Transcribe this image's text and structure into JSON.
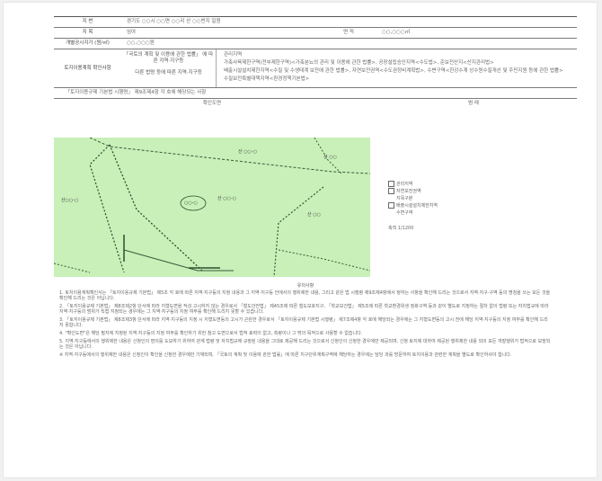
{
  "document": {
    "row1": {
      "label": "지 번",
      "value": "경기도 ○○시 ○○면 ○○리 산 ○○번지 일원"
    },
    "row2": {
      "label": "지 목",
      "value": "임야",
      "label2": "면 적",
      "value2": "○○,○○○㎡"
    },
    "row3": {
      "label": "개별공시지가 (원/㎡)",
      "value": "○○,○○○원"
    },
    "block": {
      "label": "토지이용계획 확인사항",
      "mid_items": [
        "「국토의 계획 및 이용에 관한 법률」 에 따른 지역·지구등",
        "다른 법령 등에 따른 지역·지구등"
      ],
      "right_head": "관리지역",
      "right_lines": [
        "가축사육제한구역(전부제한구역)<가축분뇨의 관리 및 이용에 관한 법률>, 공장설립승인지역<수도법>, 준보전산지<산지관리법>",
        "배출시설설치제한지역<수질 및 수생태계 보전에 관한 법률>, 자연보전권역<수도권정비계획법>, 수변구역<한강수계 상수원수질개선 및 주민지원 등에 관한 법률>",
        "수질보전특별대책지역<환경정책기본법>"
      ],
      "bottom_label": "「토지이용규제 기본법 시행령」 제9조제4항 각 호에 해당되는 사항"
    },
    "map_header": {
      "left": "확인도면",
      "right": "범 례"
    },
    "map_labels": {
      "a": "산 ○○-○",
      "b": "산 ○○",
      "c": "산○○-○",
      "d": "산 ○○-○",
      "e": "산 ○○",
      "f": "○○-○"
    },
    "legend": {
      "items": [
        "관리지역",
        "자연보전권역",
        "지목구분",
        "배출시설설치제한지역",
        "수변구역"
      ],
      "scale": "축척 1/1200"
    },
    "body": {
      "title": "유의사항",
      "paragraphs": [
        "1. 토지이용계획확인서는 「토지이용규제 기본법」 제5조 각 호에 따른 지역·지구등의 지정 내용과 그 지역·지구등 안에서의 행위제한 내용, 그리고 같은 법 시행령 제9조제4항에서 정하는 사항을 확인해 드리는 것으로서 지역·지구·구역 등의 명칭을 쓰는 모든 것을 확인해 드리는 것은 아닙니다.",
        "2. 「토지이용규제 기본법」 제8조제2항 단서에 따라 지형도면을 작성·고시하지 않는 경우로서 「철도안전법」 제45조에 따른 철도보호지구, 「학교보건법」 제5조에 따른 학교환경위생 정화구역 등과 같이 별도로 지정하는 절차 없이 법령 또는 자치법규에 따라 지역·지구등의 범위가 직접 지정되는 경우에는 그 지역·지구등의 지정 여부를 확인해 드리지 못할 수 있습니다.",
        "3. 「토지이용규제 기본법」 제8조제3항 단서에 따라 지역·지구등의 지정 시 지형도면등의 고시가 곤란한 경우로서 「토지이용규제 기본법 시행령」 제7조제4항 각 호에 해당되는 경우에는 그 지형도면등의 고시 전에 해당 지역·지구등의 지정 여부를 확인해 드리지 못합니다.",
        "4. \"확인도면\"은 해당 필지에 지정된 지역·지구등의 지정 여부를 확인하기 위한 참고 도면으로서 법적 효력이 없고, 측량이나 그 밖의 목적으로 사용할 수 없습니다.",
        "5. 지역·지구등에서의 행위제한 내용은 신청인의 편의를 도모하기 위하여 관계 법령 및 자치법규에 규정된 내용을 그대로 제공해 드리는 것으로서 신청인이 신청한 경우에만 제공되며, 신청 토지에 대하여 제공된 행위제한 내용 외의 모든 개발행위가 법적으로 보장되는 것은 아닙니다.",
        "※ 지역·지구등에서의 행위제한 내용은 신청인이 확인을 신청한 경우에만 기재되며, 「국토의 계획 및 이용에 관한 법률」에 따른 지구단위계획구역에 해당하는 경우에는 담당 과를 방문하여 토지이용과 관련한 계획을 별도로 확인하셔야 합니다."
      ]
    }
  }
}
